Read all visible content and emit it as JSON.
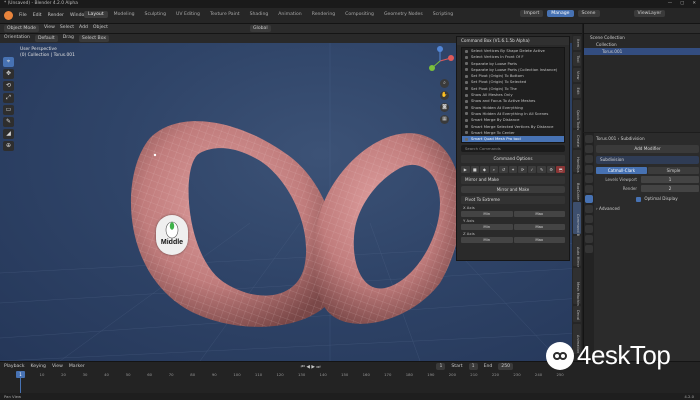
{
  "title_bar": {
    "title": "* (Unsaved) - Blender 4.2.0 Alpha",
    "controls": [
      "—",
      "▢",
      "✕"
    ]
  },
  "menu": {
    "items": [
      "File",
      "Edit",
      "Render",
      "Window",
      "Help"
    ],
    "workspace_tabs": [
      "Layout",
      "Modeling",
      "Sculpting",
      "UV Editing",
      "Texture Paint",
      "Shading",
      "Animation",
      "Rendering",
      "Compositing",
      "Geometry Nodes",
      "Scripting"
    ],
    "active_tab": "Layout",
    "scene_label": "Scene",
    "view_layer_label": "ViewLayer",
    "import_btn": "Import",
    "manage_btn": "Manage"
  },
  "viewport_header": {
    "mode": "Object Mode",
    "menus": [
      "View",
      "Select",
      "Add",
      "Object"
    ],
    "transform": "Global",
    "sub": [
      "Orientation",
      "Default",
      "Drag",
      "Select Box"
    ]
  },
  "viewport": {
    "view_name": "User Perspective",
    "collection": "(0) Collection | Torus.001",
    "mouse_label": "Middle",
    "tool_icons": [
      "⌖",
      "✥",
      "⟲",
      "⤢",
      "▭",
      "✎",
      "◢",
      "⊕"
    ]
  },
  "command_box": {
    "title": "Command Box (V1.6.1.5b Alpha)",
    "items": [
      "Select Vertices By Shape Delete Active",
      "Select Vertices In Front Of F",
      "Separate by Loose Parts",
      "Separate by Loose Parts (Collection Instance)",
      "Set Pivot (Origin) To Bottom",
      "Set Pivot (Origin) To Selected",
      "Set Pivot (Origin) To The",
      "Show All Meshes Only",
      "Show and Focus To Active Meshes",
      "Show Hidden At Everything",
      "Show Hidden At Everything In All Scenes",
      "Smart Merge By Distance",
      "Smart Merge Selected Vertices By Distance",
      "Smart Merge To Center",
      "Smart Quad Mesh Pro tool"
    ],
    "selected_index": 14,
    "search_placeholder": "Search Commands",
    "options_title": "Command Options",
    "tool_buttons": [
      "▶",
      "■",
      "◆",
      "⌕",
      "↺",
      "✦",
      "⟳",
      "✓",
      "✎",
      "⚙",
      "⬒"
    ],
    "mirror_section": "Mirror and Make",
    "mirror_btn": "Mirror and Make",
    "pivot_section": "Pivot To Extreme",
    "axes": [
      {
        "label": "X Axis",
        "min": "Min",
        "max": "Max"
      },
      {
        "label": "Y Axis",
        "min": "Min",
        "max": "Max"
      },
      {
        "label": "Z Axis",
        "min": "Min",
        "max": "Max"
      }
    ]
  },
  "n_panel_tabs": [
    "Item",
    "Tool",
    "View",
    "Edit",
    "Quick Tools",
    "Create",
    "HardOps",
    "BoxCutter",
    "Command Box",
    "Auto Mirror",
    "Mesh Machine",
    "Decal",
    "Animation"
  ],
  "outliner": {
    "rows": [
      {
        "label": "Scene Collection",
        "indent": 0,
        "selected": false
      },
      {
        "label": "Collection",
        "indent": 1,
        "selected": false
      },
      {
        "label": "Torus.001",
        "indent": 2,
        "selected": true
      }
    ]
  },
  "properties": {
    "object": "Torus.001",
    "modifier_type": "Subdivision",
    "add_modifier": "Add Modifier",
    "modifier_name": "Subdivision",
    "segment": [
      "Catmull-Clark",
      "Simple"
    ],
    "segment_active": 0,
    "fields": [
      {
        "label": "Levels Viewport",
        "value": "1"
      },
      {
        "label": "Render",
        "value": "2"
      }
    ],
    "optimal_display": "Optimal Display",
    "advanced": "Advanced"
  },
  "timeline": {
    "menus": [
      "Playback",
      "Keying",
      "View",
      "Marker"
    ],
    "frame": "1",
    "ticks": [
      "0",
      "10",
      "20",
      "30",
      "40",
      "50",
      "60",
      "70",
      "80",
      "90",
      "100",
      "110",
      "120",
      "130",
      "140",
      "150",
      "160",
      "170",
      "180",
      "190",
      "200",
      "210",
      "220",
      "230",
      "240",
      "250"
    ],
    "start_label": "Start",
    "start": "1",
    "end_label": "End",
    "end": "250"
  },
  "status_bar": {
    "text": "Pan View",
    "version": "4.2.0"
  },
  "watermark": {
    "text": "4eskTop"
  },
  "colors": {
    "accent": "#4772b3",
    "torus": "#c88484",
    "viewport_bg": "#2f4468"
  }
}
